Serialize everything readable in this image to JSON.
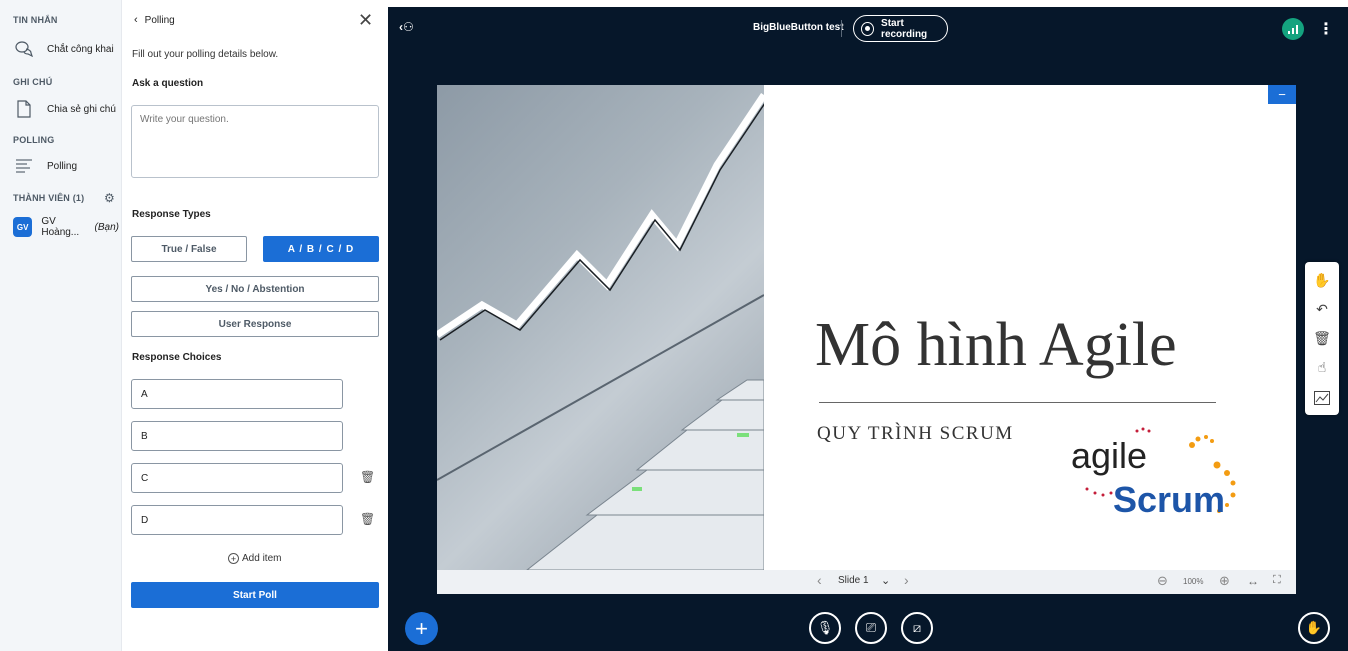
{
  "nav": {
    "messages_header": "TIN NHẮN",
    "public_chat": "Chắt công khai",
    "notes_header": "GHI CHÚ",
    "shared_notes": "Chia sẻ ghi chú",
    "polling_header": "POLLING",
    "polling_item": "Polling",
    "users_header": "THÀNH VIÊN (1)",
    "user_initials": "GV",
    "user_name": "GV Hoàng...",
    "user_you": "(Bạn)"
  },
  "poll": {
    "back_label": "Polling",
    "intro": "Fill out your polling details below.",
    "question_heading": "Ask a question",
    "question_placeholder": "Write your question.",
    "response_types_heading": "Response Types",
    "type_true_false": "True / False",
    "type_abcd": "A / B / C / D",
    "type_yes_no": "Yes / No / Abstention",
    "type_user_response": "User Response",
    "choices_heading": "Response Choices",
    "choices": [
      "A",
      "B",
      "C",
      "D"
    ],
    "add_item": "Add item",
    "start_poll": "Start Poll"
  },
  "topbar": {
    "meeting_title": "BigBlueButton test",
    "record_label": "Start recording"
  },
  "slide": {
    "title": "Mô hình Agile",
    "subtitle": "QUY TRÌNH SCRUM",
    "logo_agile": "agile",
    "logo_scrum": "Scrum",
    "slide_label": "Slide 1",
    "zoom": "100%"
  },
  "colors": {
    "accent": "#1b6ed6",
    "stage_bg": "#06172a",
    "connection": "#14a37f"
  }
}
